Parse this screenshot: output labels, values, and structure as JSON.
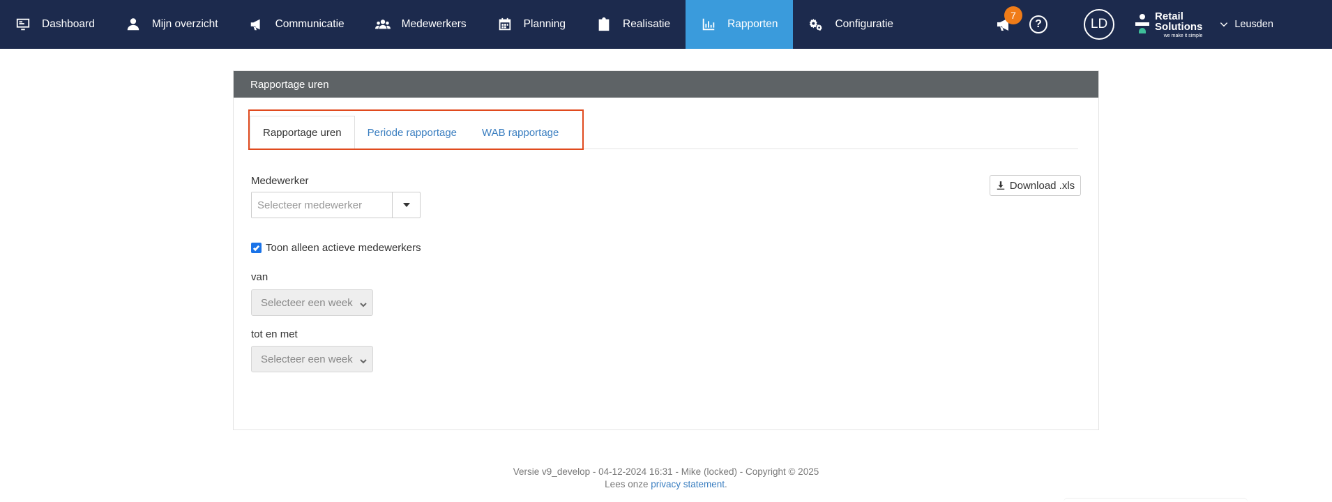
{
  "nav": {
    "items": [
      {
        "label": "Dashboard",
        "icon": "monitor-icon"
      },
      {
        "label": "Mijn overzicht",
        "icon": "user-icon"
      },
      {
        "label": "Communicatie",
        "icon": "megaphone-icon"
      },
      {
        "label": "Medewerkers",
        "icon": "users-icon"
      },
      {
        "label": "Planning",
        "icon": "calendar-icon"
      },
      {
        "label": "Realisatie",
        "icon": "clipboard-icon"
      },
      {
        "label": "Rapporten",
        "icon": "bar-chart-icon",
        "active": true
      },
      {
        "label": "Configuratie",
        "icon": "gears-icon"
      }
    ],
    "notification_count": "7",
    "help_symbol": "?",
    "avatar_initials": "LD",
    "brand_line1": "Retail",
    "brand_line2": "Solutions",
    "brand_tagline": "we make it simple",
    "location": "Leusden"
  },
  "panel": {
    "heading": "Rapportage uren",
    "tabs": [
      {
        "label": "Rapportage uren",
        "active": true
      },
      {
        "label": "Periode rapportage",
        "active": false
      },
      {
        "label": "WAB rapportage",
        "active": false
      }
    ],
    "medewerker_label": "Medewerker",
    "medewerker_placeholder": "Selecteer medewerker",
    "active_only_label": "Toon alleen actieve medewerkers",
    "active_only_checked": true,
    "van_label": "van",
    "van_value": "Selecteer een week",
    "tot_label": "tot en met",
    "tot_value": "Selecteer een week",
    "download_label": "Download .xls"
  },
  "footer": {
    "version_line": "Versie v9_develop - 04-12-2024 16:31 - Mike (locked) - Copyright © 2025",
    "privacy_prefix": "Lees onze",
    "privacy_link": "privacy statement",
    "privacy_suffix": "."
  },
  "colors": {
    "nav_bg": "#1c2a4d",
    "nav_active": "#3a9bdc",
    "badge": "#f07c18",
    "panel_heading": "#5e6366",
    "link": "#3a7ec0",
    "highlight": "#e04a1e"
  }
}
